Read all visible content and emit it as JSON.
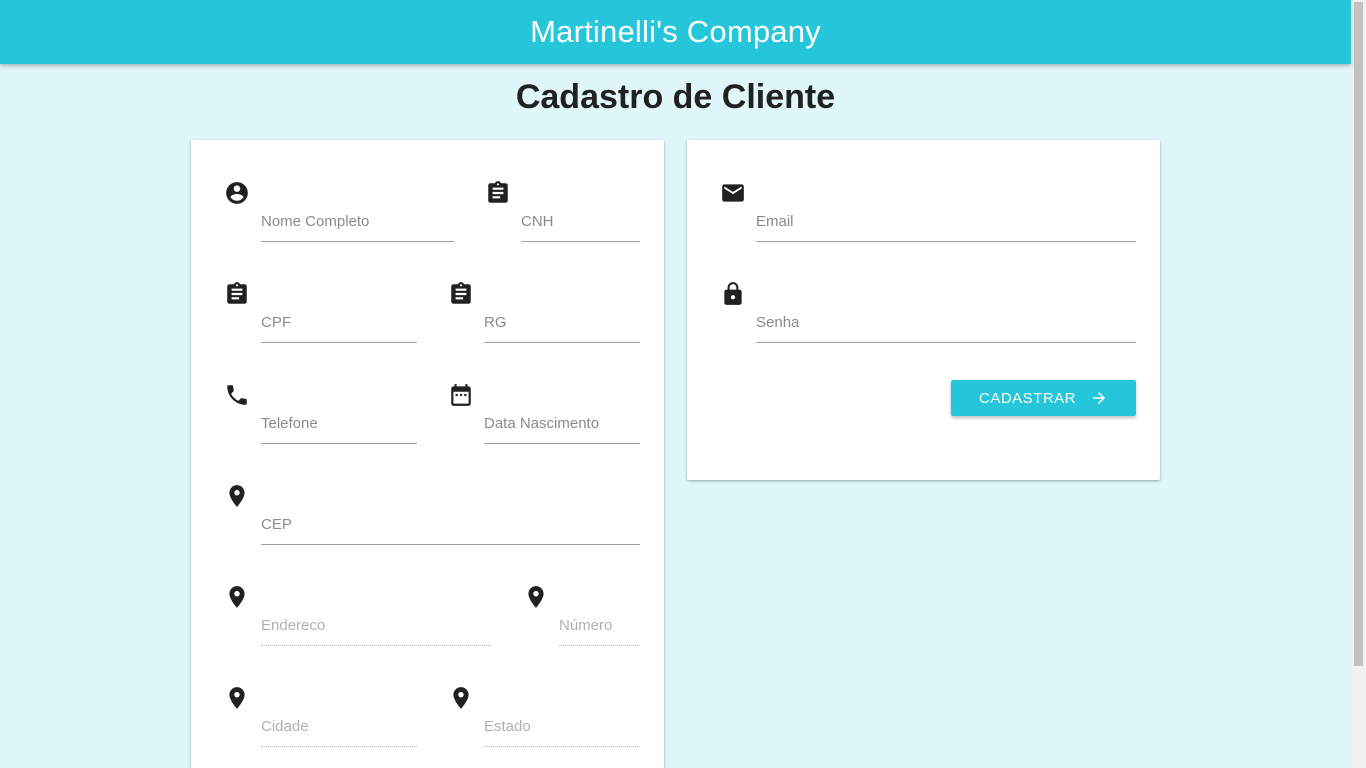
{
  "app": {
    "title": "Martinelli's Company"
  },
  "page": {
    "title": "Cadastro de Cliente"
  },
  "form": {
    "nome": {
      "placeholder": "Nome Completo",
      "icon": "account-circle-icon"
    },
    "cnh": {
      "placeholder": "CNH",
      "icon": "clipboard-icon"
    },
    "cpf": {
      "placeholder": "CPF",
      "icon": "clipboard-icon"
    },
    "rg": {
      "placeholder": "RG",
      "icon": "clipboard-icon"
    },
    "telefone": {
      "placeholder": "Telefone",
      "icon": "phone-icon"
    },
    "nascimento": {
      "placeholder": "Data Nascimento",
      "icon": "calendar-icon"
    },
    "cep": {
      "placeholder": "CEP",
      "icon": "location-pin-icon"
    },
    "endereco": {
      "placeholder": "Endereco",
      "icon": "location-pin-icon"
    },
    "numero": {
      "placeholder": "Número",
      "icon": "location-pin-icon"
    },
    "cidade": {
      "placeholder": "Cidade",
      "icon": "location-pin-icon"
    },
    "estado": {
      "placeholder": "Estado",
      "icon": "location-pin-icon"
    },
    "email": {
      "placeholder": "Email",
      "icon": "mail-icon"
    },
    "senha": {
      "placeholder": "Senha",
      "icon": "lock-icon"
    },
    "submit_label": "CADASTRAR"
  },
  "colors": {
    "primary": "#26c6da",
    "background": "#e0f7fa",
    "text": "#212121"
  }
}
